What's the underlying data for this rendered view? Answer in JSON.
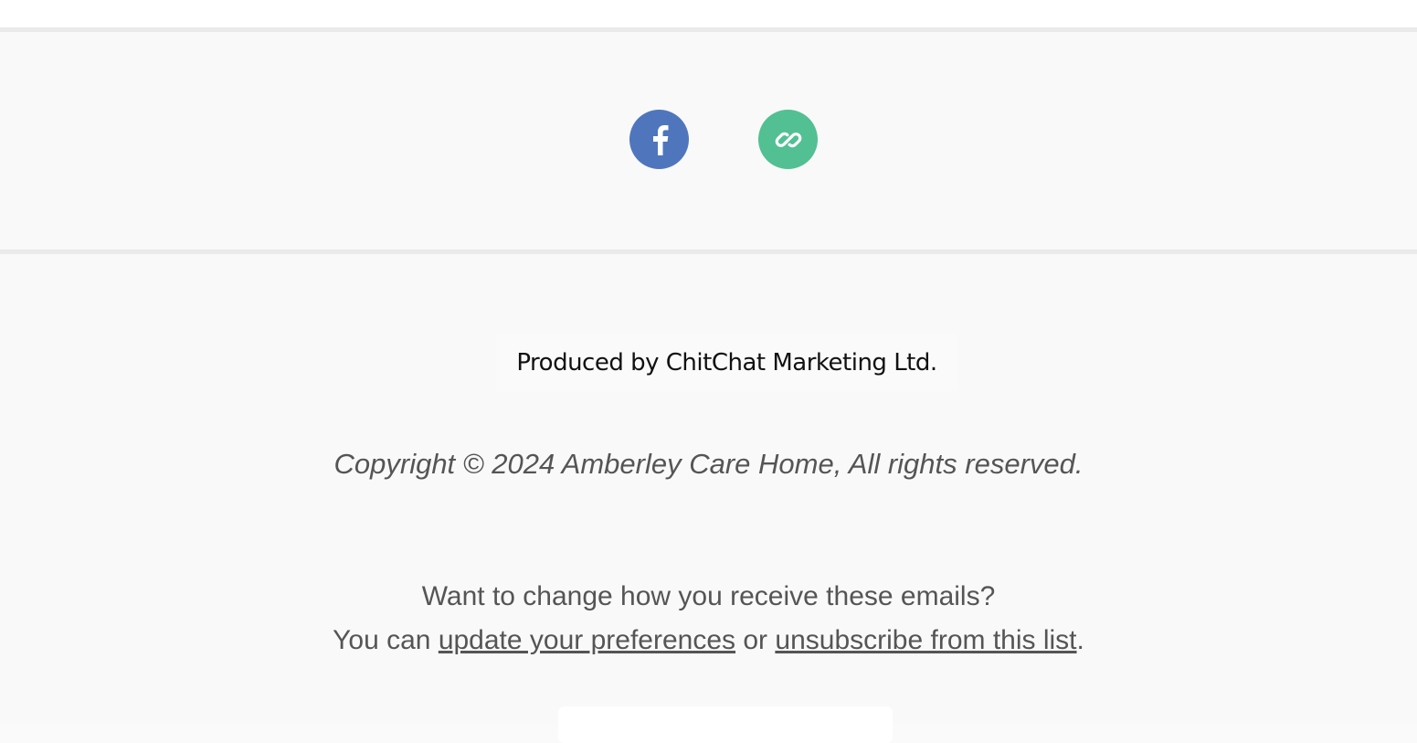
{
  "social": {
    "facebook": {
      "icon": "facebook-icon",
      "color": "#4f76bd"
    },
    "website": {
      "icon": "link-icon",
      "color": "#52c092"
    }
  },
  "footer": {
    "produced_by": "Produced by ChitChat Marketing Ltd.",
    "copyright": "Copyright © 2024 Amberley Care Home, All rights reserved.",
    "pref_question": "Want to change how you receive these emails?",
    "pref_prefix": "You can ",
    "update_link": "update your preferences",
    "pref_or": " or ",
    "unsubscribe_link": "unsubscribe from this list",
    "pref_suffix": "."
  }
}
